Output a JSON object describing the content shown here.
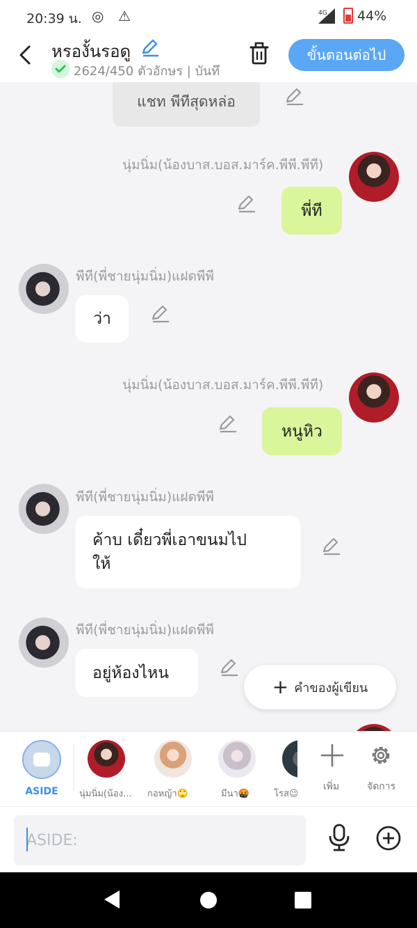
{
  "status_bar": {
    "time": "20:39 น.",
    "network": "4G",
    "battery": "44%"
  },
  "header": {
    "title": "หรองั้นรอดู",
    "char_count": "2624/450 ตัวอักษร | บันทึ",
    "next_label": "ขั้นตอนต่อไป"
  },
  "chat": {
    "center_message": "แชท พีทีสุดหล่อ",
    "messages": [
      {
        "sender": "นุ่มนิ่ม(น้องบาส.บอส.มาร์ค.พีพี.พีที)",
        "text": "พี่ที",
        "side": "right"
      },
      {
        "sender": "พีที(พี่ชายนุ่มนิ่ม)แฝดพีพี",
        "text": "ว่า",
        "side": "left"
      },
      {
        "sender": "นุ่มนิ่ม(น้องบาส.บอส.มาร์ค.พีพี.พีที)",
        "text": "หนูหิว",
        "side": "right"
      },
      {
        "sender": "พีที(พี่ชายนุ่มนิ่ม)แฝดพีพี",
        "text": "ค้าบ เดี๋ยวพี่เอาขนมไป\nให้",
        "side": "left"
      },
      {
        "sender": "พีที(พี่ชายนุ่มนิ่ม)แฝดพีพี",
        "text": "อยู่ห้องไหน",
        "side": "left"
      }
    ],
    "author_note_label": "คำของผู้เขียน"
  },
  "character_bar": {
    "aside_label": "ASIDE",
    "characters": [
      {
        "label": "นุ่มนิ่ม(น้อง..."
      },
      {
        "label": "กอหญ้า🙄"
      },
      {
        "label": "มีนา🤬"
      },
      {
        "label": "โรส😉"
      }
    ],
    "add_label": "เพิ่ม",
    "manage_label": "จัดการ"
  },
  "input": {
    "placeholder": "ASIDE:",
    "value": ""
  },
  "colors": {
    "accent_blue": "#5aa7f5",
    "bubble_green": "#d9f69b",
    "check_green": "#22c55e"
  },
  "icons": [
    "back-icon",
    "pencil-icon",
    "check-icon",
    "trash-icon",
    "plus-icon",
    "gear-icon",
    "mic-icon",
    "add-circle-icon"
  ]
}
